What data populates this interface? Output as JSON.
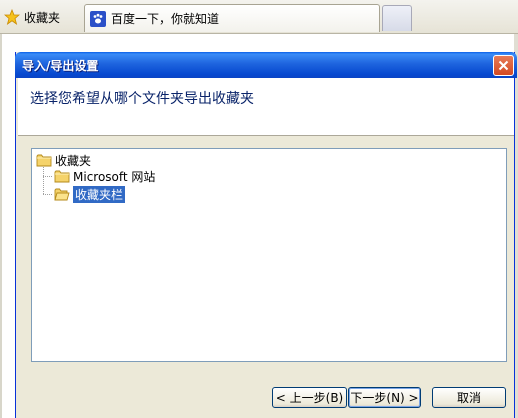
{
  "browser": {
    "favorites_label": "收藏夹",
    "tab_title": "百度一下，你就知道"
  },
  "dialog": {
    "title": "导入/导出设置",
    "instruction": "选择您希望从哪个文件夹导出收藏夹",
    "tree": {
      "root": "收藏夹",
      "children": [
        {
          "label": "Microsoft 网站",
          "selected": false
        },
        {
          "label": "收藏夹栏",
          "selected": true
        }
      ]
    },
    "buttons": {
      "back": "< 上一步(B)",
      "next": "下一步(N) >",
      "cancel": "取消"
    }
  },
  "colors": {
    "titlebar": "#0a5fe8",
    "selection": "#316ac5",
    "dialog_bg": "#ece9d8",
    "header_text": "#0a246a"
  },
  "icons": {
    "favorites": "star-icon",
    "tab": "baidu-paw-icon",
    "close": "close-icon",
    "folder": "folder-icon"
  }
}
